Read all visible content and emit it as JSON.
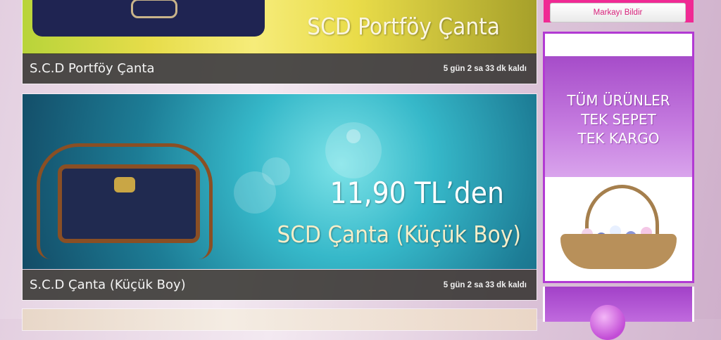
{
  "deals": [
    {
      "name": "S.C.D Portföy Çanta",
      "time_left": "5 gün 2 sa 33 dk kaldı",
      "banner_title": "SCD Portföy Çanta"
    },
    {
      "name": "S.C.D Çanta (Küçük Boy)",
      "time_left": "5 gün 2 sa 33 dk kaldı",
      "banner_price": "11,90 TL’den",
      "banner_title": "SCD Çanta (Küçük Boy)"
    }
  ],
  "sidebar": {
    "report_button": "Markayı Bildir",
    "promo_lines": [
      "TÜM ÜRÜNLER",
      "TEK SEPET",
      "TEK KARGO"
    ]
  },
  "colors": {
    "accent_pink": "#f02a94",
    "promo_purple": "#b23ad3"
  },
  "icons": [
    "handbag-image",
    "flower-basket-image"
  ]
}
